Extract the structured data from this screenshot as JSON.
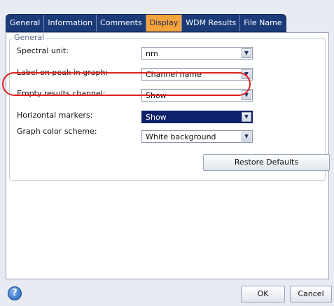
{
  "tabs": [
    {
      "label": "General"
    },
    {
      "label": "Information"
    },
    {
      "label": "Comments"
    },
    {
      "label": "Display"
    },
    {
      "label": "WDM Results"
    },
    {
      "label": "File Name"
    }
  ],
  "active_tab": "Display",
  "group_title": "General",
  "settings": [
    {
      "label": "Spectral unit:",
      "value": "nm"
    },
    {
      "label": "Label on peak in graph:",
      "value": "Channel name"
    },
    {
      "label": "Empty results channel:",
      "value": "Show"
    },
    {
      "label": "Horizontal markers:",
      "value": "Show"
    },
    {
      "label": "Graph color scheme:",
      "value": "White background"
    }
  ],
  "restore_defaults_label": "Restore Defaults",
  "ok_label": "OK",
  "cancel_label": "Cancel",
  "help_glyph": "?",
  "colors": {
    "tab_bar": "#1b3a78",
    "active_tab": "#f6a33b",
    "highlight": "#e02020",
    "selected_field": "#0d226a"
  }
}
